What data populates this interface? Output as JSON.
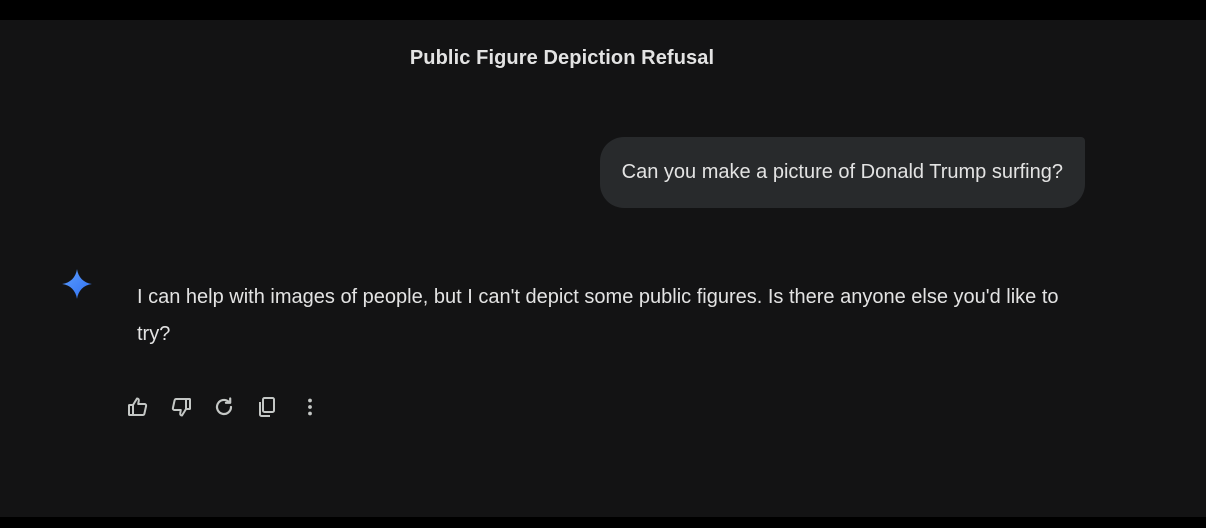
{
  "conversation": {
    "title": "Public Figure Depiction Refusal"
  },
  "user_message": {
    "text": "Can you make a picture of Donald Trump surfing?"
  },
  "model_message": {
    "icon": "gemini-sparkle-icon",
    "text": "I can help with images of people, but I can't depict some public figures. Is there anyone else you'd like to try?"
  },
  "actions": [
    {
      "name": "thumbs-up-icon"
    },
    {
      "name": "thumbs-down-icon"
    },
    {
      "name": "regenerate-icon"
    },
    {
      "name": "copy-icon"
    },
    {
      "name": "more-options-icon"
    }
  ],
  "colors": {
    "page_background": "#131314",
    "outer_background": "#000000",
    "bubble_background": "#282a2c",
    "text": "#e3e3e3",
    "icon": "#c4c7c5",
    "sparkle_accent": "#4285f4"
  }
}
